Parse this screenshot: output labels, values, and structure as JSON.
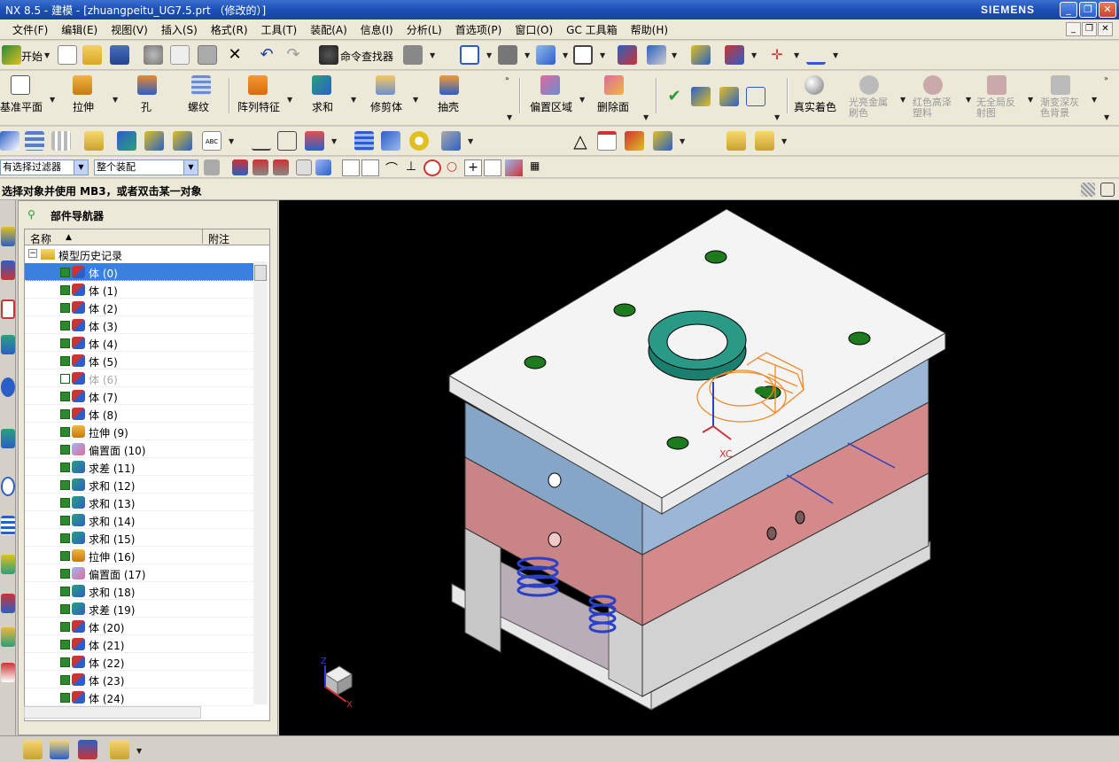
{
  "titlebar": {
    "app": "NX 8.5",
    "module": "建模",
    "file": "[zhuangpeitu_UG7.5.prt （修改的）]",
    "brand": "SIEMENS"
  },
  "menu": [
    "文件(F)",
    "编辑(E)",
    "视图(V)",
    "插入(S)",
    "格式(R)",
    "工具(T)",
    "装配(A)",
    "信息(I)",
    "分析(L)",
    "首选项(P)",
    "窗口(O)",
    "GC 工具箱",
    "帮助(H)"
  ],
  "standard_toolbar": {
    "start_label": "开始",
    "command_finder_label": "命令查找器"
  },
  "feature_toolbar": {
    "items": [
      "基准平面",
      "拉伸",
      "孔",
      "螺纹",
      "阵列特征",
      "求和",
      "修剪体",
      "抽壳",
      "偏置区域",
      "删除面",
      "真实着色"
    ],
    "disabled_items": [
      "光亮金属刷色",
      "红色高泽塑料",
      "无全局反射图",
      "渐变深灰色背景"
    ]
  },
  "filterbar": {
    "type_filter": "有选择过滤器",
    "scope": "整个装配"
  },
  "cue_line": "选择对象并使用 MB3，或者双击某一对象",
  "navigator": {
    "title": "部件导航器",
    "columns": [
      "名称",
      "附注"
    ],
    "root": "模型历史记录",
    "rows": [
      {
        "name": "体 (0)",
        "checked": true,
        "selected": true,
        "icon": "body"
      },
      {
        "name": "体 (1)",
        "checked": true,
        "icon": "body"
      },
      {
        "name": "体 (2)",
        "checked": true,
        "icon": "body"
      },
      {
        "name": "体 (3)",
        "checked": true,
        "icon": "body"
      },
      {
        "name": "体 (4)",
        "checked": true,
        "icon": "body"
      },
      {
        "name": "体 (5)",
        "checked": true,
        "icon": "body"
      },
      {
        "name": "体 (6)",
        "checked": false,
        "icon": "body"
      },
      {
        "name": "体 (7)",
        "checked": true,
        "icon": "body"
      },
      {
        "name": "体 (8)",
        "checked": true,
        "icon": "body"
      },
      {
        "name": "拉伸 (9)",
        "checked": true,
        "icon": "extrude"
      },
      {
        "name": "偏置面 (10)",
        "checked": true,
        "icon": "offset"
      },
      {
        "name": "求差 (11)",
        "checked": true,
        "icon": "boolean"
      },
      {
        "name": "求和 (12)",
        "checked": true,
        "icon": "boolean"
      },
      {
        "name": "求和 (13)",
        "checked": true,
        "icon": "boolean"
      },
      {
        "name": "求和 (14)",
        "checked": true,
        "icon": "boolean"
      },
      {
        "name": "求和 (15)",
        "checked": true,
        "icon": "boolean"
      },
      {
        "name": "拉伸 (16)",
        "checked": true,
        "icon": "extrude"
      },
      {
        "name": "偏置面 (17)",
        "checked": true,
        "icon": "offset"
      },
      {
        "name": "求和 (18)",
        "checked": true,
        "icon": "boolean"
      },
      {
        "name": "求差 (19)",
        "checked": true,
        "icon": "boolean"
      },
      {
        "name": "体 (20)",
        "checked": true,
        "icon": "body"
      },
      {
        "name": "体 (21)",
        "checked": true,
        "icon": "body"
      },
      {
        "name": "体 (22)",
        "checked": true,
        "icon": "body"
      },
      {
        "name": "体 (23)",
        "checked": true,
        "icon": "body"
      },
      {
        "name": "体 (24)",
        "checked": true,
        "icon": "body"
      }
    ]
  },
  "viewport": {
    "csys_label": "XC",
    "triad": {
      "z": "Z",
      "x": "X"
    }
  },
  "colors": {
    "plate_top": "#f0f0f0",
    "plate_blue": "#8faed0",
    "plate_red": "#c78484",
    "ring": "#1f8a7a",
    "wireframe": "#f08a2a",
    "background": "#000000"
  }
}
